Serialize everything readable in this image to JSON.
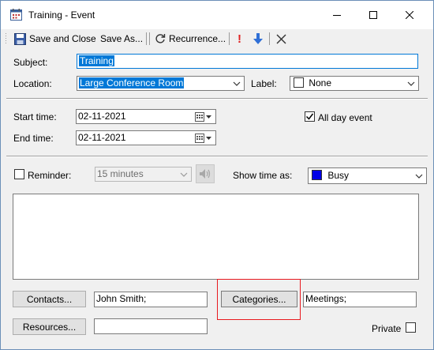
{
  "window": {
    "title": "Training - Event"
  },
  "toolbar": {
    "save_close": "Save and Close",
    "save_as": "Save As...",
    "recurrence": "Recurrence...",
    "importance_high": "!"
  },
  "form": {
    "subject_label": "Subject:",
    "subject_value": "Training",
    "location_label": "Location:",
    "location_value": "Large Conference Room",
    "label_label": "Label:",
    "label_value": "None",
    "start_label": "Start time:",
    "start_value": "02-11-2021",
    "end_label": "End time:",
    "end_value": "02-11-2021",
    "allday_label": "All day event",
    "allday_checked": true,
    "reminder_label": "Reminder:",
    "reminder_value": "15 minutes",
    "reminder_checked": false,
    "showtime_label": "Show time as:",
    "showtime_value": "Busy",
    "busy_color": "#0000e6"
  },
  "footer": {
    "contacts_button": "Contacts...",
    "contacts_value": "John Smith;",
    "categories_button": "Categories...",
    "categories_value": "Meetings;",
    "resources_button": "Resources...",
    "resources_value": "",
    "private_label": "Private",
    "private_checked": false
  },
  "colors": {
    "highlight_box": "#e8191f",
    "selection": "#0078d7"
  }
}
